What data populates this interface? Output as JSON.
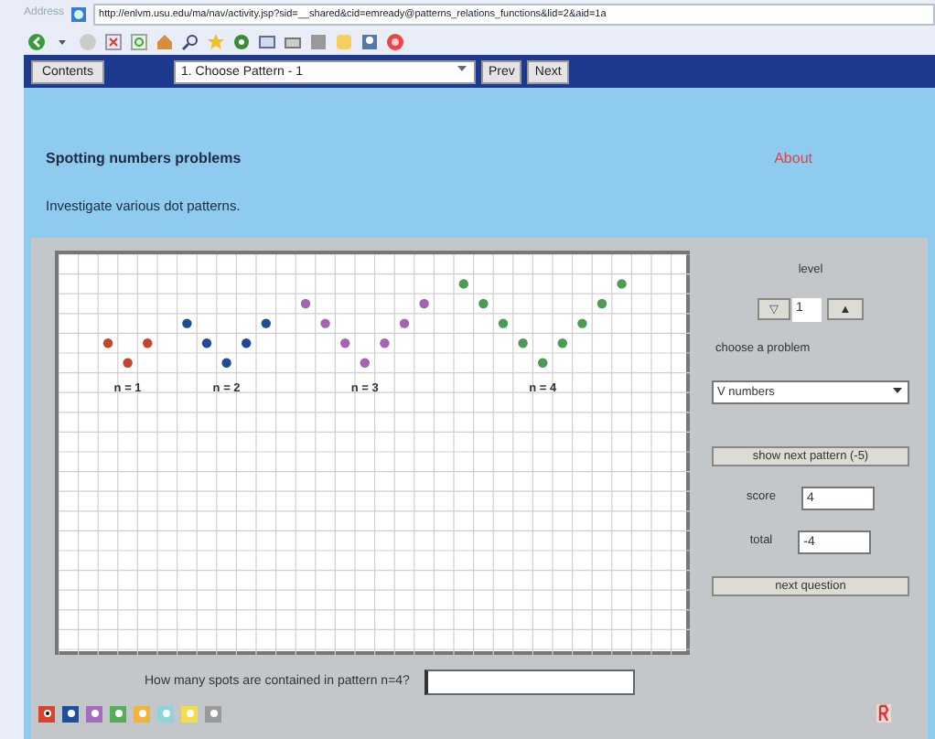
{
  "browser": {
    "address_label": "Address",
    "url": "http://enlvm.usu.edu/ma/nav/activity.jsp?sid=__shared&cid=emready@patterns_relations_functions&lid=2&aid=1a"
  },
  "navbar": {
    "contents_button": "Contents",
    "page_select": "1. Choose Pattern - 1",
    "prev_button": "Prev",
    "next_button": "Next"
  },
  "header": {
    "title": "Spotting numbers problems",
    "about_link": "About",
    "instructions": "Investigate various dot patterns."
  },
  "patterns": [
    {
      "label": "n = 1",
      "color": "#c6432c"
    },
    {
      "label": "n = 2",
      "color": "#1f4b96"
    },
    {
      "label": "n = 3",
      "color": "#a564b3"
    },
    {
      "label": "n = 4",
      "color": "#4b9a55"
    }
  ],
  "controls": {
    "level_label": "level",
    "level_down": "▽",
    "level_value": "1",
    "level_up": "▲",
    "problem_label": "choose a problem",
    "problem_select": "V numbers",
    "show_next_button": "show next pattern (-5)",
    "score_label": "score",
    "score_value": "4",
    "total_label": "total",
    "total_value": "-4",
    "next_question_button": "next question"
  },
  "question": {
    "text": "How many spots are contained in pattern n=4?"
  },
  "swatches": [
    {
      "color": "#d8452e",
      "selected": true
    },
    {
      "color": "#1c4f9c",
      "selected": false
    },
    {
      "color": "#a66cc0",
      "selected": false
    },
    {
      "color": "#55ad5a",
      "selected": false
    },
    {
      "color": "#f0b43a",
      "selected": false
    },
    {
      "color": "#8fd3dd",
      "selected": false
    },
    {
      "color": "#f2df4a",
      "selected": false
    },
    {
      "color": "#9a9a9a",
      "selected": false
    }
  ]
}
